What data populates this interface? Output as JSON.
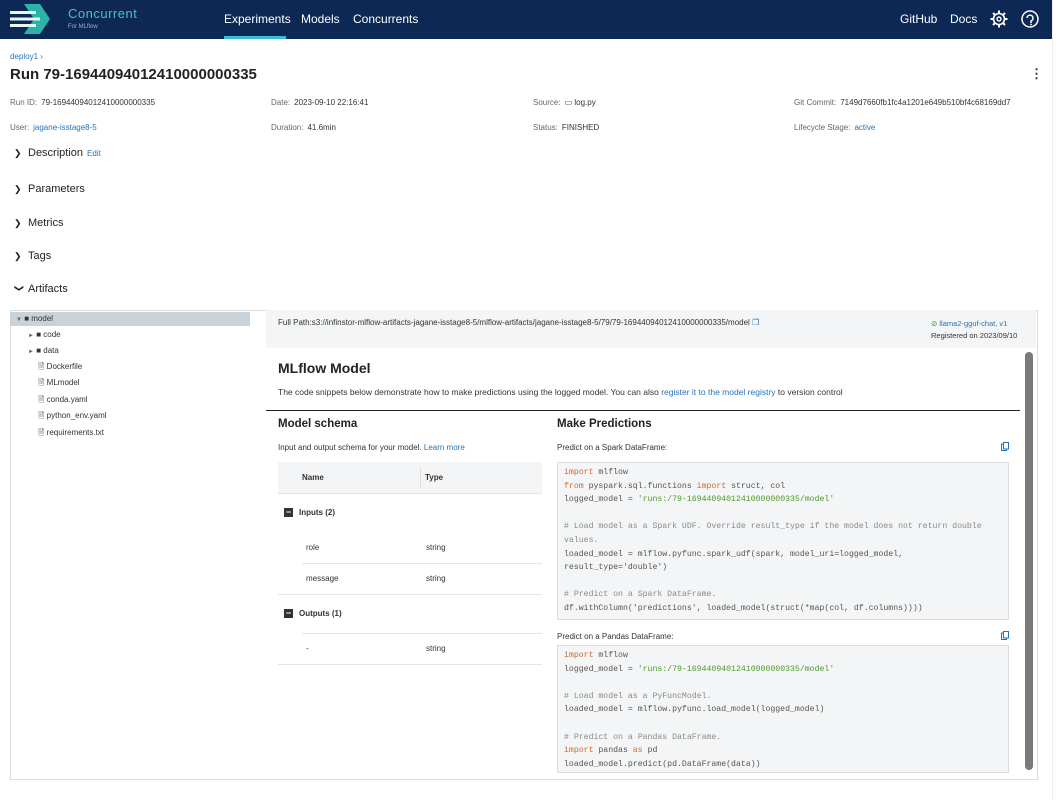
{
  "header": {
    "brand": "Concurrent",
    "brand_sub": "For MLflow",
    "nav": [
      "Experiments",
      "Models",
      "Concurrents"
    ],
    "links": [
      "GitHub",
      "Docs"
    ],
    "icons": [
      "gear-icon",
      "support-icon"
    ]
  },
  "breadcrumb": "deploy1",
  "run_title": "Run 79-16944094012410000000335",
  "meta": {
    "run_id_label": "Run ID:",
    "run_id": "79-16944094012410000000335",
    "date_label": "Date:",
    "date": "2023-09-10 22:16:41",
    "source_label": "Source:",
    "source": "log.py",
    "git_label": "Git Commit:",
    "git": "7149d7660fb1fc4a1201e649b510bf4c68169dd7",
    "user_label": "User:",
    "user": "jagane-isstage8-5",
    "duration_label": "Duration:",
    "duration": "41.6min",
    "status_label": "Status:",
    "status": "FINISHED",
    "lifecycle_label": "Lifecycle Stage:",
    "lifecycle": "active"
  },
  "sections": {
    "description": "Description",
    "edit": "Edit",
    "parameters": "Parameters",
    "metrics": "Metrics",
    "tags": "Tags",
    "artifacts": "Artifacts"
  },
  "tree": {
    "model": "model",
    "code": "code",
    "data": "data",
    "files": [
      "Dockerfile",
      "MLmodel",
      "conda.yaml",
      "python_env.yaml",
      "requirements.txt"
    ]
  },
  "artifact": {
    "full_path": "Full Path:s3://infinstor-mlflow-artifacts-jagane-isstage8-5/mlflow-artifacts/jagane-isstage8-5/79/79-16944094012410000000335/model",
    "registered_model": "llama2-gguf-chat, v1",
    "registered_on": "Registered on 2023/09/10"
  },
  "mlflow_panel": {
    "title": "MLflow Model",
    "desc_pre": "The code snippets below demonstrate how to make predictions using the logged model. You can also ",
    "desc_link": "register it to the model registry",
    "desc_post": " to version control"
  },
  "schema": {
    "title": "Model schema",
    "desc": "Input and output schema for your model.",
    "learn_more": "Learn more",
    "col_name": "Name",
    "col_type": "Type",
    "inputs_label": "Inputs (2)",
    "inputs": [
      {
        "name": "role",
        "type": "string"
      },
      {
        "name": "message",
        "type": "string"
      }
    ],
    "outputs_label": "Outputs (1)",
    "outputs": [
      {
        "name": "-",
        "type": "string"
      }
    ]
  },
  "predict": {
    "title": "Make Predictions",
    "spark_label": "Predict on a Spark DataFrame:",
    "pandas_label": "Predict on a Pandas DataFrame:"
  },
  "colors": {
    "topbar": "#0d2855",
    "accent": "#3eb8d6",
    "link": "#2374bb",
    "keyword": "#cf6a2c",
    "string": "#4e9a2a"
  }
}
